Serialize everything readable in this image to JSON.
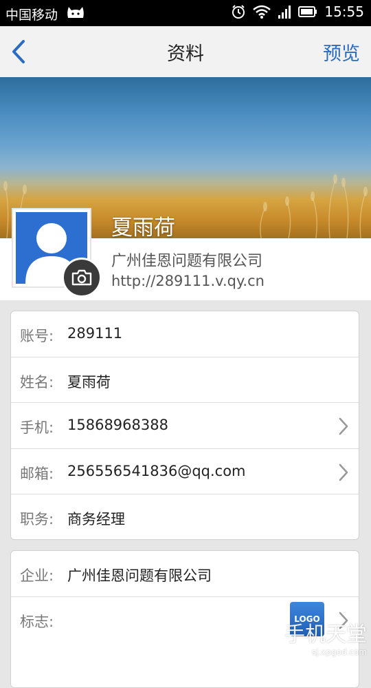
{
  "status_bar": {
    "carrier": "中国移动",
    "time": "15:55",
    "icons": [
      "cat-icon",
      "alarm-icon",
      "wifi-icon",
      "signal-icon",
      "battery-icon"
    ]
  },
  "navbar": {
    "back_icon": "chevron-left-icon",
    "title": "资料",
    "preview_label": "预览",
    "accent_color": "#2a6cc4"
  },
  "profile": {
    "name": "夏雨荷",
    "company": "广州佳恩问题有限公司",
    "url": "http://289111.v.qy.cn",
    "camera_icon": "camera-icon",
    "avatar_color": "#2d6fd0"
  },
  "personal_fields": [
    {
      "label": "账号:",
      "value": "289111",
      "has_arrow": false
    },
    {
      "label": "姓名:",
      "value": "夏雨荷",
      "has_arrow": false
    },
    {
      "label": "手机:",
      "value": "15868968388",
      "has_arrow": true
    },
    {
      "label": "邮箱:",
      "value": "256556541836@qq.com",
      "has_arrow": true
    },
    {
      "label": "职务:",
      "value": "商务经理",
      "has_arrow": false
    }
  ],
  "company_fields": [
    {
      "label": "企业:",
      "value": "广州佳恩问题有限公司",
      "has_arrow": false
    },
    {
      "label": "标志:",
      "value": "",
      "has_arrow": true,
      "logo_text": "LOGO"
    }
  ],
  "watermark": {
    "main": "手机天堂",
    "sub": "sj.xpgod.com"
  }
}
